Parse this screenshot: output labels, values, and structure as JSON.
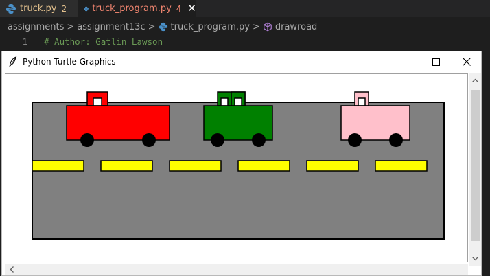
{
  "editor": {
    "tabs": [
      {
        "label": "truck.py",
        "problems": "2"
      },
      {
        "label": "truck_program.py",
        "problems": "4",
        "close": "✕"
      }
    ],
    "breadcrumb": [
      "assignments",
      "assignment13c",
      "truck_program.py",
      "drawroad"
    ],
    "breadcrumb_sep": ">",
    "code": {
      "line_number": "1",
      "text": "# Author: Gatlin Lawson"
    }
  },
  "window": {
    "title": "Python Turtle Graphics",
    "buttons": {
      "minimize": "minimize-icon",
      "maximize": "maximize-icon",
      "close": "close-icon"
    }
  },
  "scene": {
    "road_color": "#808080",
    "lane_color": "#ffff00",
    "wheel_color": "#000000",
    "window_color": "#ffffff",
    "trucks": [
      {
        "name": "red truck",
        "color": "#ff0000",
        "windows": 1
      },
      {
        "name": "green truck",
        "color": "#008000",
        "windows": 2
      },
      {
        "name": "pink truck",
        "color": "#ffc0cb",
        "windows": 1
      }
    ],
    "lane_markings": 6
  },
  "colors": {
    "editor_bg": "#1e1e1e",
    "tab_warning": "#e2c08d",
    "tab_error": "#f48771",
    "comment": "#6a9955",
    "symbol_icon": "#b180d7"
  }
}
